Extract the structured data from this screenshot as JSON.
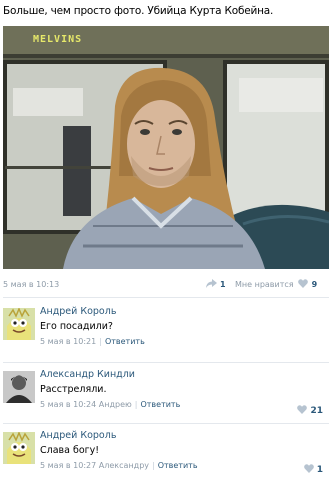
{
  "post": {
    "title": "Больше, чем просто фото. Убийца Курта Кобейна.",
    "bus_sign": "MELVINS",
    "time": "5 мая в 10:13",
    "share_count": "1",
    "like_label": "Мне нравится",
    "like_count": "9"
  },
  "comments": [
    {
      "author": "Андрей Король",
      "text": "Его посадили?",
      "time": "5 мая в 10:21",
      "reply_to": "",
      "reply_label": "Ответить",
      "likes": ""
    },
    {
      "author": "Александр Киндли",
      "text": "Расстреляли.",
      "time": "5 мая в 10:24",
      "reply_to": "Андрею",
      "reply_label": "Ответить",
      "likes": "21"
    },
    {
      "author": "Андрей Король",
      "text": "Слава богу!",
      "time": "5 мая в 10:27",
      "reply_to": "Александру",
      "reply_label": "Ответить",
      "likes": "1"
    }
  ],
  "colors": {
    "link": "#2b587a",
    "muted": "#8e9ba8",
    "divider": "#e4e8ed"
  },
  "icons": [
    "share-icon",
    "heart-icon"
  ]
}
